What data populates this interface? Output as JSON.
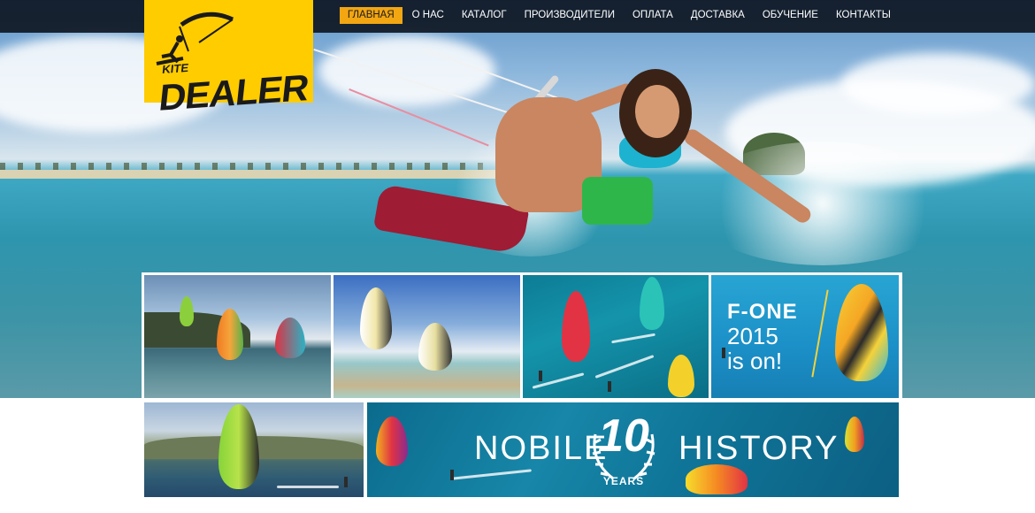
{
  "brand": {
    "logo_text_small": "KITE",
    "logo_text_main": "DEALER",
    "logo_color": "#ffcc00"
  },
  "nav": {
    "items": [
      {
        "label": "ГЛАВНАЯ",
        "active": true
      },
      {
        "label": "О НАС",
        "active": false
      },
      {
        "label": "КАТАЛОГ",
        "active": false
      },
      {
        "label": "ПРОИЗВОДИТЕЛИ",
        "active": false
      },
      {
        "label": "ОПЛАТА",
        "active": false
      },
      {
        "label": "ДОСТАВКА",
        "active": false
      },
      {
        "label": "ОБУЧЕНИЕ",
        "active": false
      },
      {
        "label": "КОНТАКТЫ",
        "active": false
      }
    ],
    "active_color": "#f2a612"
  },
  "tiles": {
    "fone": {
      "line1": "F-ONE",
      "line2": "2015",
      "line3": "is on!"
    },
    "history": {
      "left": "NOBILE",
      "right": "HISTORY",
      "badge_number": "10",
      "badge_caption": "YEARS"
    }
  },
  "icons": [
    "kitesurfer-logo-icon",
    "laurel-wreath-icon"
  ]
}
